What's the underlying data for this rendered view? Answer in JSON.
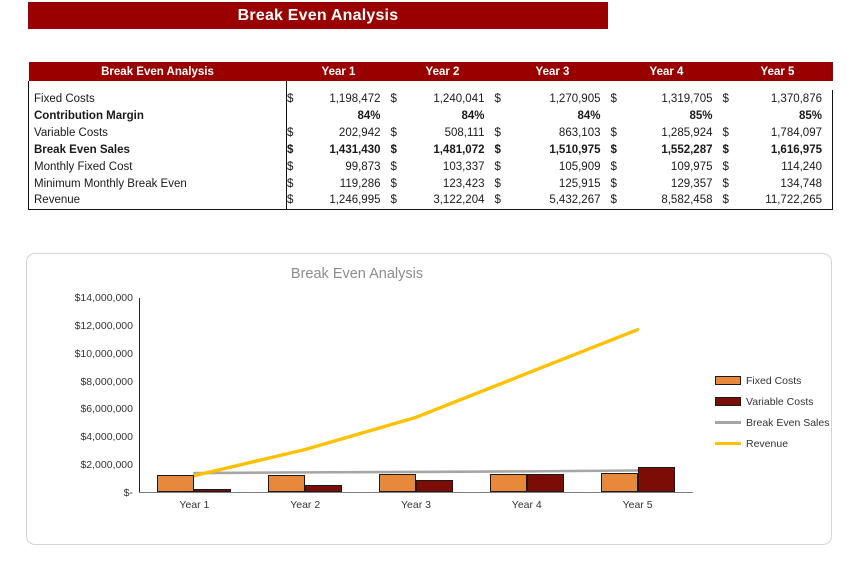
{
  "banner": {
    "title": "Break Even Analysis"
  },
  "table": {
    "headers": [
      "Break Even Analysis",
      "Year 1",
      "Year 2",
      "Year 3",
      "Year 4",
      "Year 5"
    ],
    "currency_symbol": "$",
    "rows": [
      {
        "label": "Fixed Costs",
        "bold": false,
        "currency": true,
        "values": [
          "1,198,472",
          "1,240,041",
          "1,270,905",
          "1,319,705",
          "1,370,876"
        ]
      },
      {
        "label": "Contribution Margin",
        "bold": true,
        "currency": false,
        "values": [
          "84%",
          "84%",
          "84%",
          "85%",
          "85%"
        ]
      },
      {
        "label": "Variable Costs",
        "bold": false,
        "currency": true,
        "values": [
          "202,942",
          "508,111",
          "863,103",
          "1,285,924",
          "1,784,097"
        ]
      },
      {
        "label": "Break Even Sales",
        "bold": true,
        "currency": true,
        "values": [
          "1,431,430",
          "1,481,072",
          "1,510,975",
          "1,552,287",
          "1,616,975"
        ]
      },
      {
        "label": "Monthly Fixed Cost",
        "bold": false,
        "currency": true,
        "values": [
          "99,873",
          "103,337",
          "105,909",
          "109,975",
          "114,240"
        ]
      },
      {
        "label": "Minimum Monthly Break Even",
        "bold": false,
        "currency": true,
        "values": [
          "119,286",
          "123,423",
          "125,915",
          "129,357",
          "134,748"
        ]
      },
      {
        "label": "Revenue",
        "bold": false,
        "currency": true,
        "values": [
          "1,246,995",
          "3,122,204",
          "5,432,267",
          "8,582,458",
          "11,722,265"
        ]
      }
    ]
  },
  "colors": {
    "brand_red": "#990000",
    "fixed_costs": "#E8883A",
    "variable_costs": "#7B0C06",
    "break_even_sales": "#A6A6A6",
    "revenue": "#FFC000",
    "chart_title": "#8C8C8C"
  },
  "chart_data": {
    "type": "bar",
    "title": "Break Even Analysis",
    "xlabel": "",
    "ylabel": "",
    "categories": [
      "Year 1",
      "Year 2",
      "Year 3",
      "Year 4",
      "Year 5"
    ],
    "ylim": [
      0,
      14000000
    ],
    "grid": false,
    "legend_position": "right",
    "ytick_labels": [
      "$14,000,000",
      "$12,000,000",
      "$10,000,000",
      "$8,000,000",
      "$6,000,000",
      "$4,000,000",
      "$2,000,000",
      "$-"
    ],
    "ytick_values": [
      14000000,
      12000000,
      10000000,
      8000000,
      6000000,
      4000000,
      2000000,
      0
    ],
    "series": [
      {
        "name": "Fixed Costs",
        "type": "bar",
        "color": "#E8883A",
        "values": [
          1198472,
          1240041,
          1270905,
          1319705,
          1370876
        ]
      },
      {
        "name": "Variable Costs",
        "type": "bar",
        "color": "#7B0C06",
        "values": [
          202942,
          508111,
          863103,
          1285924,
          1784097
        ]
      },
      {
        "name": "Break Even Sales",
        "type": "line",
        "color": "#A6A6A6",
        "values": [
          1431430,
          1481072,
          1510975,
          1552287,
          1616975
        ]
      },
      {
        "name": "Revenue",
        "type": "line",
        "color": "#FFC000",
        "values": [
          1246995,
          3122204,
          5432267,
          8582458,
          11722265
        ]
      }
    ]
  }
}
